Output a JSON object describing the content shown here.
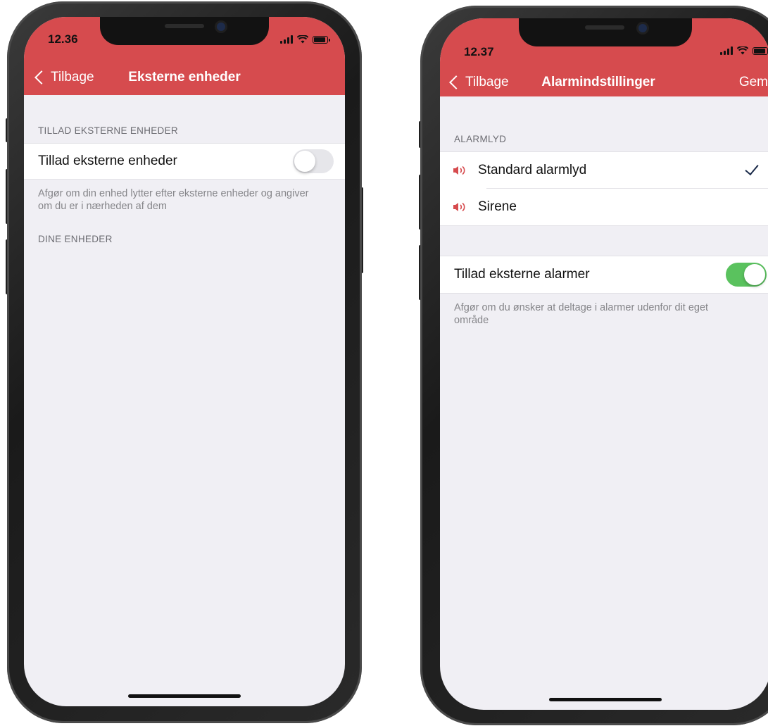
{
  "colors": {
    "header_red": "#d64b4e",
    "toggle_on": "#5ac25e",
    "background": "#f0eff4"
  },
  "left_screen": {
    "time": "12.36",
    "back_label": "Tilbage",
    "title": "Eksterne enheder",
    "section1_header": "TILLAD EKSTERNE ENHEDER",
    "toggle_label": "Tillad eksterne enheder",
    "toggle_on": false,
    "footnote": "Afgør om din enhed lytter efter eksterne enheder og angiver om du er i nærheden af dem",
    "section2_header": "DINE ENHEDER"
  },
  "right_screen": {
    "time": "12.37",
    "back_label": "Tilbage",
    "title": "Alarmindstillinger",
    "save_label": "Gem",
    "section_header": "ALARMLYD",
    "sounds": [
      {
        "label": "Standard alarmlyd",
        "icon": "speaker-icon",
        "selected": true
      },
      {
        "label": "Sirene",
        "icon": "speaker-icon",
        "selected": false
      }
    ],
    "toggle_label": "Tillad eksterne alarmer",
    "toggle_on": true,
    "footnote": "Afgør om du ønsker at deltage i alarmer udenfor dit eget område"
  }
}
